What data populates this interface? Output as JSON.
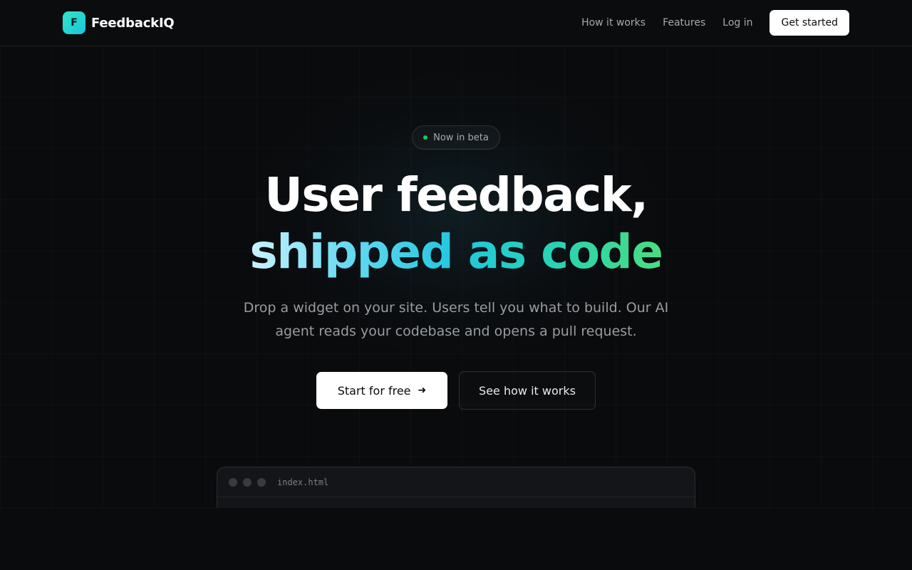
{
  "nav": {
    "logo_letter": "F",
    "brand": "FeedbackIQ",
    "links": [
      "How it works",
      "Features",
      "Log in"
    ],
    "cta": "Get started"
  },
  "hero": {
    "badge": "Now in beta",
    "headline_line1": "User feedback,",
    "headline_line2": "shipped as code",
    "subtitle": "Drop a widget on your site. Users tell you what to build. Our AI agent reads your codebase and opens a pull request.",
    "primary_cta": "Start for free",
    "primary_cta_icon": "arrow-right-icon",
    "secondary_cta": "See how it works"
  },
  "code_window": {
    "filename": "index.html"
  },
  "colors": {
    "background": "#0a0b0d",
    "accent_teal": "#22c7de",
    "accent_green": "#4ade80",
    "badge_dot": "#22c55e"
  }
}
